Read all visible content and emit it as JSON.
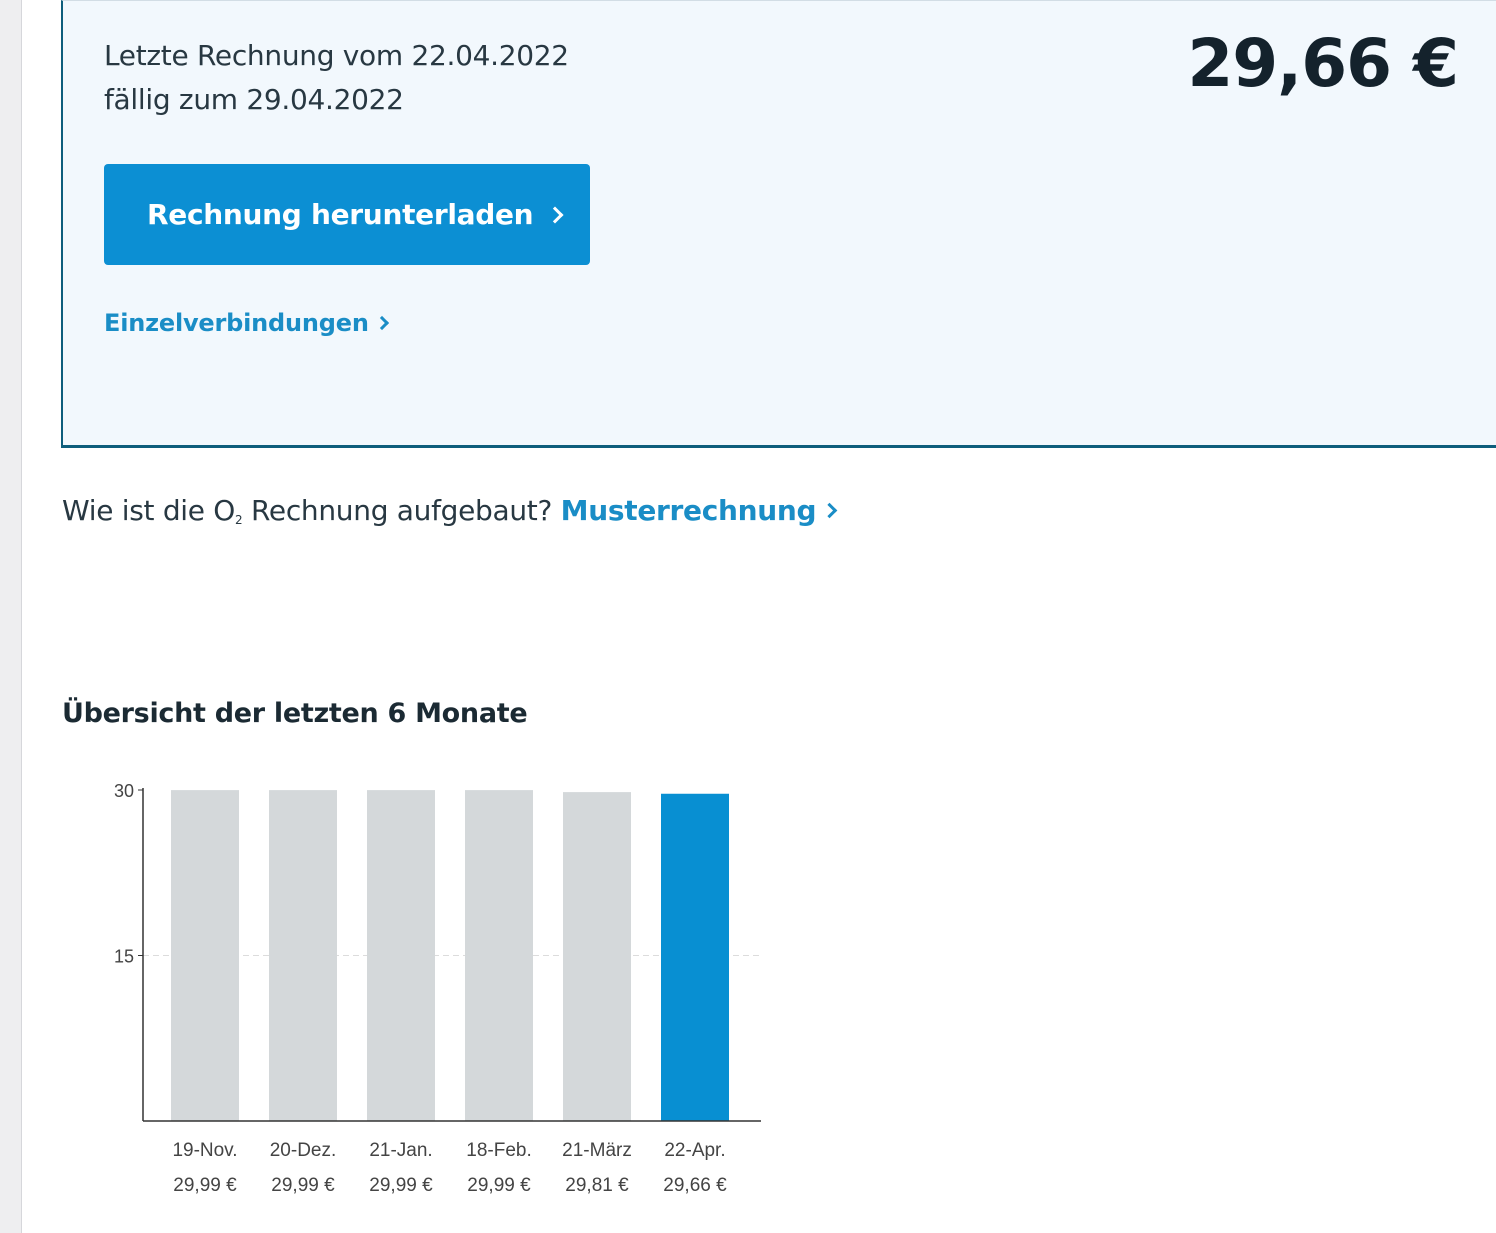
{
  "bill": {
    "line1": "Letzte Rechnung vom 22.04.2022",
    "line2": "fällig zum 29.04.2022",
    "amount": "29,66 €",
    "download_label": "Rechnung herunterladen",
    "details_label": "Einzelverbindungen"
  },
  "sample": {
    "question_pre": "Wie ist die O",
    "question_sub": "2",
    "question_post": " Rechnung aufgebaut?",
    "link_label": "Musterrechnung"
  },
  "overview": {
    "title": "Übersicht der letzten 6 Monate"
  },
  "colors": {
    "accent": "#0c8fd3",
    "bar_past": "#d4d8da",
    "bar_current": "#088fd2",
    "link": "#1a8dc6"
  },
  "chart_data": {
    "type": "bar",
    "categories": [
      "19-Nov.",
      "20-Dez.",
      "21-Jan.",
      "18-Feb.",
      "21-März",
      "22-Apr."
    ],
    "values": [
      29.99,
      29.99,
      29.99,
      29.99,
      29.81,
      29.66
    ],
    "value_labels": [
      "29,99 €",
      "29,99 €",
      "29,99 €",
      "29,99 €",
      "29,81 €",
      "29,66 €"
    ],
    "highlight_index": 5,
    "y_ticks": [
      "15",
      "30"
    ],
    "ylim": [
      0,
      30
    ],
    "grid": "dashed line at 15",
    "legend": "none"
  }
}
